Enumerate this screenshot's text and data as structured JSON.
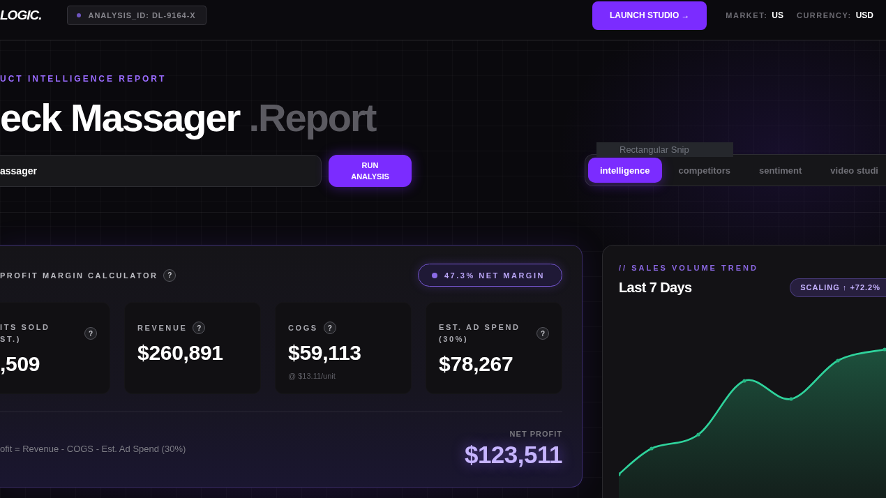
{
  "header": {
    "logo": "LOGIC.",
    "analysis_id": "ANALYSIS_ID: DL-9164-X",
    "launch_button": "LAUNCH STUDIO →",
    "market": {
      "label": "MARKET:",
      "value": "US"
    },
    "currency": {
      "label": "CURRENCY:",
      "value": "USD"
    }
  },
  "hero": {
    "eyebrow": "UCT INTELLIGENCE REPORT",
    "title": "eck Massager",
    "title_suffix": ".Report",
    "search": {
      "value": "assager"
    },
    "run_button": "RUN ANALYSIS",
    "tabs": [
      {
        "label": "intelligence",
        "selected": true
      },
      {
        "label": "competitors",
        "selected": false
      },
      {
        "label": "sentiment",
        "selected": false
      },
      {
        "label": "video studi",
        "selected": false
      }
    ]
  },
  "snip_tooltip": {
    "label": "Rectangular Snip"
  },
  "profit_calculator": {
    "title": "PROFIT MARGIN CALCULATOR",
    "help": "?",
    "margin_badge": "47.3% NET MARGIN",
    "metrics": [
      {
        "label": "ITS SOLD ST.)",
        "help": "?",
        "value": ",509"
      },
      {
        "label": "REVENUE",
        "help": "?",
        "value": "$260,891"
      },
      {
        "label": "COGS",
        "help": "?",
        "value": "$59,113",
        "note": "@ $13.11/unit"
      },
      {
        "label": "EST. AD SPEND (30%)",
        "help": "?",
        "value": "$78,267"
      }
    ],
    "formula": "ofit = Revenue - COGS - Est. Ad Spend (30%)",
    "net_profit": {
      "label": "NET PROFIT",
      "value": "$123,511"
    }
  },
  "sales_trend": {
    "eyebrow": "// SALES VOLUME TREND",
    "title": "Last 7 Days",
    "badge": "SCALING ↑ +72.2%"
  }
}
